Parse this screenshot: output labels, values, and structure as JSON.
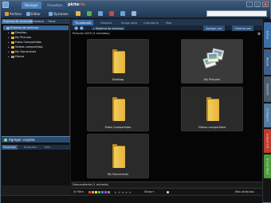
{
  "app": {
    "top_tabs": [
      "Navegar",
      "Visualizar"
    ],
    "brand_prefix": "picto",
    "brand_suffix": "ria",
    "window_controls": [
      "–",
      "□",
      "✕"
    ]
  },
  "toolbar": {
    "items": [
      "Archivo",
      "Editar",
      "Opciones"
    ]
  },
  "sidebar": {
    "tabs": [
      "Sistema de archivos",
      "Biblioteca",
      "Otros"
    ],
    "root": "Sistema de archivos",
    "items": [
      "Desktop",
      "My Pictures",
      "Fotos Compartidas",
      "Vídeos compartidos",
      "My Documents",
      "Discos"
    ],
    "add_folder": "Agregar carpeta",
    "bottom_tabs": [
      "Favoritos",
      "Atributos",
      "Info"
    ]
  },
  "content": {
    "tabs": [
      "Thumbnails",
      "Historial",
      "Image data",
      "Calendario",
      "Map"
    ],
    "nav_back": "◀",
    "nav_forward": "▶",
    "breadcrumb": "Sistema de archivos",
    "actions": [
      "Agregar por",
      "Ordenar por"
    ],
    "header": "Pictures 2009 (5 entradas)",
    "tiles": [
      "Desktop",
      "My Pictures",
      "Fotos Compartidas",
      "Vídeos compartidos",
      "My Documents"
    ],
    "status": "Descendiente (1 entrada)"
  },
  "bottom_bar": {
    "filter_label": "Filtro",
    "stars_label": "Show",
    "right_label": "Mas atributos",
    "colors": [
      "#e04040",
      "#f0a030",
      "#f0e040",
      "#50c050",
      "#4080e0",
      "#a050d0",
      "#888888"
    ]
  },
  "right_rail": {
    "tabs": [
      {
        "label": "Editar",
        "color": "#3d6fa8"
      },
      {
        "label": "Album",
        "color": "#3f5f88"
      },
      {
        "label": "Imprimir",
        "color": "#4b5c6c"
      },
      {
        "label": "Compartir",
        "color": "#567a9f"
      },
      {
        "label": "Grabar CD",
        "color": "#c23b2b"
      },
      {
        "label": "Enviar Web",
        "color": "#4c9a3a"
      }
    ]
  }
}
